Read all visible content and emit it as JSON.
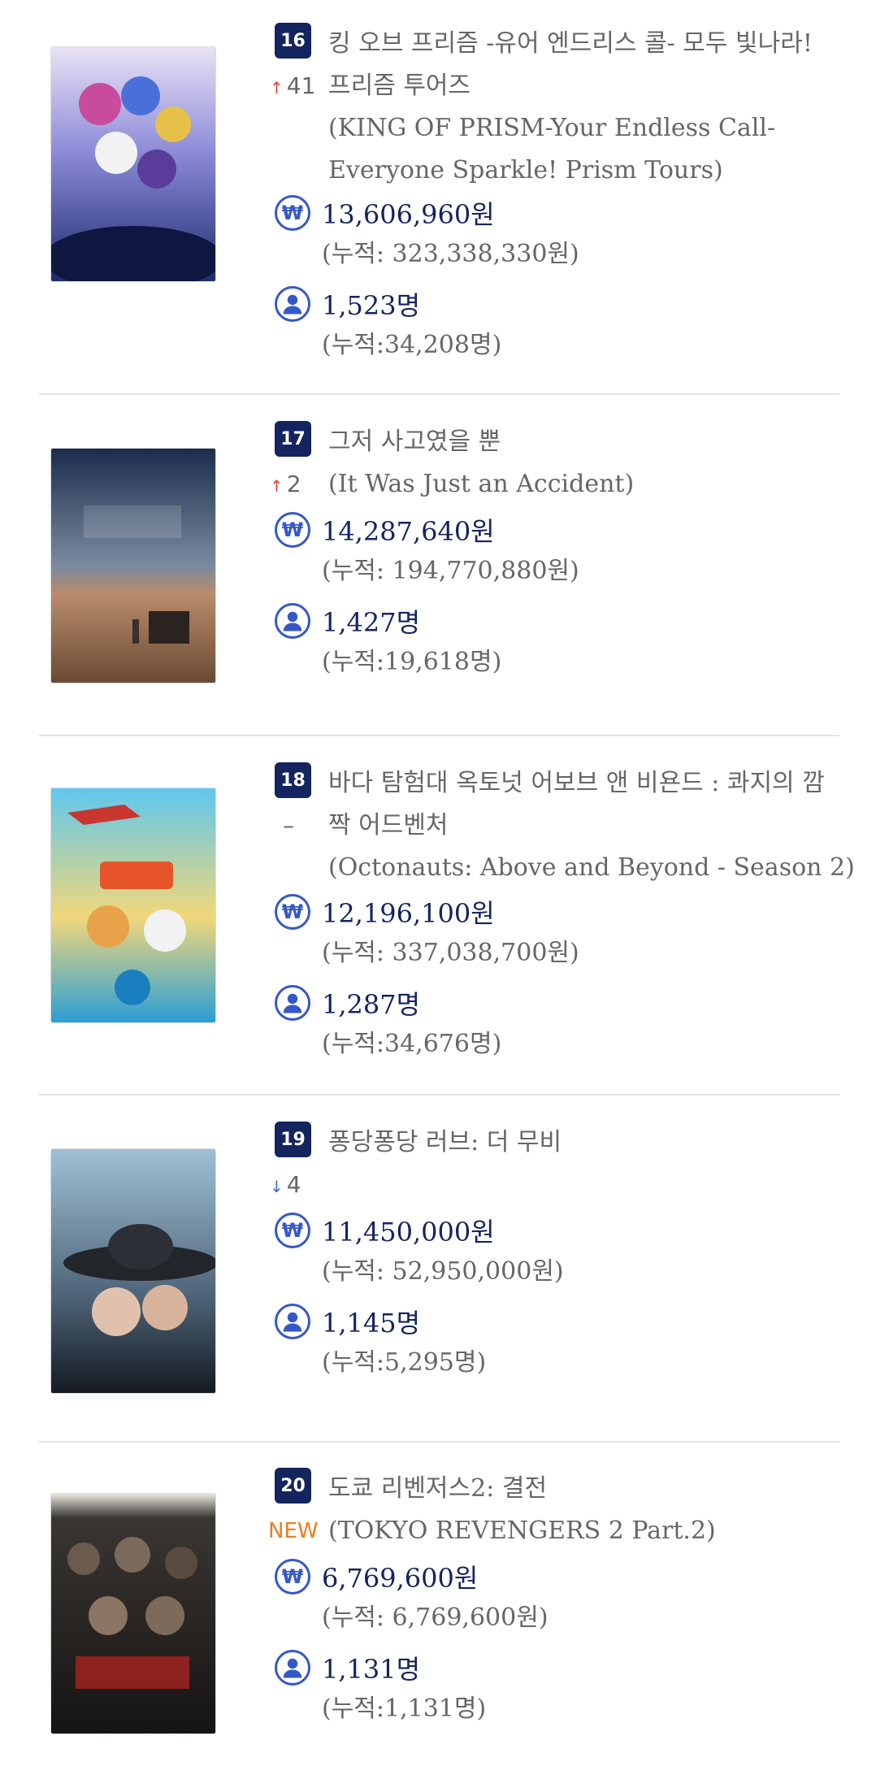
{
  "movies": [
    {
      "rank": "16",
      "change": "41",
      "title_ko": "킹 오브 프리즘 -유어 엔드리스 콜- 모두 빛나라!",
      "title_ko_2": "프리즘 투어즈",
      "title_en_1": "(KING OF PRISM-Your Endless Call-",
      "title_en_2": "Everyone Sparkle! Prism Tours)",
      "sales": "13,606,960원",
      "sales_total": "(누적: 323,338,330원)",
      "audience": "1,523명",
      "audience_total": "(누적:34,208명)"
    },
    {
      "rank": "17",
      "change": "2",
      "title_ko": "그저 사고였을 뿐",
      "title_en": "(It Was Just an Accident)",
      "sales": "14,287,640원",
      "sales_total": "(누적: 194,770,880원)",
      "audience": "1,427명",
      "audience_total": "(누적:19,618명)"
    },
    {
      "rank": "18",
      "change": "–",
      "title_ko": "바다 탐험대 옥토넛 어보브 앤 비욘드 : 콰지의 깜",
      "title_ko_2": "짝 어드벤처",
      "title_en": "(Octonauts: Above and Beyond - Season 2)",
      "sales": "12,196,100원",
      "sales_total": "(누적: 337,038,700원)",
      "audience": "1,287명",
      "audience_total": "(누적:34,676명)"
    },
    {
      "rank": "19",
      "change": "4",
      "title_ko": "퐁당퐁당 러브: 더 무비",
      "sales": "11,450,000원",
      "sales_total": "(누적: 52,950,000원)",
      "audience": "1,145명",
      "audience_total": "(누적:5,295명)"
    },
    {
      "rank": "20",
      "change": "NEW",
      "title_ko": "도쿄 리벤저스2: 결전",
      "title_en": "(TOKYO REVENGERS 2 Part.2)",
      "sales": "6,769,600원",
      "sales_total": "(누적: 6,769,600원)",
      "audience": "1,131명",
      "audience_total": "(누적:1,131명)"
    }
  ],
  "icons": {
    "won": "won-icon",
    "audience": "person-icon"
  },
  "colors": {
    "rank_bg": "#14245f",
    "accent": "#3558c8",
    "up": "#e0463c",
    "down": "#3f6fc8",
    "new": "#f07b1f"
  }
}
